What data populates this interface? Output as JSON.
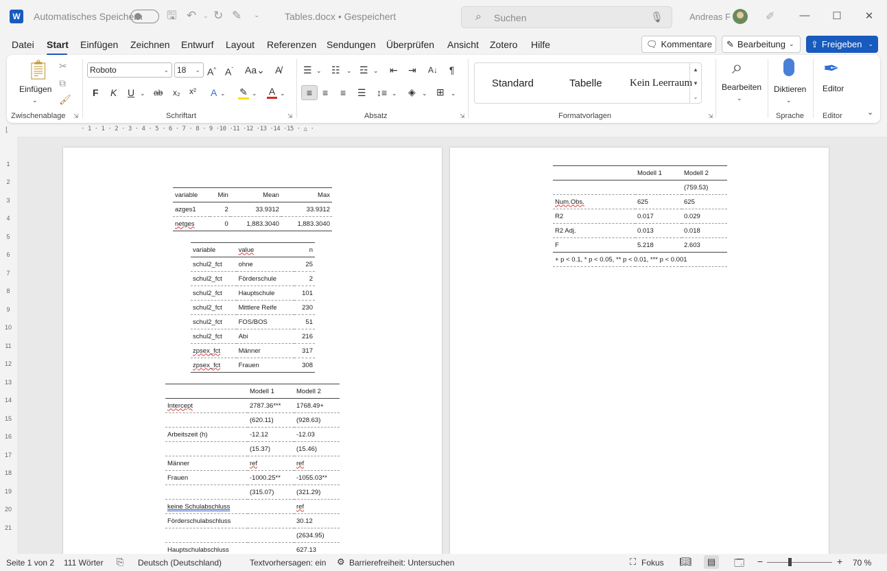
{
  "titlebar": {
    "autosave_label": "Automatisches Speichern",
    "doc_title": "Tables.docx • Gespeichert",
    "search_placeholder": "Suchen",
    "user_name": "Andreas F"
  },
  "menu": {
    "tabs": [
      "Datei",
      "Start",
      "Einfügen",
      "Zeichnen",
      "Entwurf",
      "Layout",
      "Referenzen",
      "Sendungen",
      "Überprüfen",
      "Ansicht",
      "Zotero",
      "Hilfe"
    ],
    "active": "Start",
    "comments_label": "Kommentare",
    "editing_label": "Bearbeitung",
    "share_label": "Freigeben"
  },
  "ribbon": {
    "paste_label": "Einfügen",
    "font_name": "Roboto",
    "font_size": "18",
    "styles": [
      "Standard",
      "Tabelle",
      "Kein Leerraum"
    ],
    "edit_label": "Bearbeiten",
    "dictate_label": "Diktieren",
    "editor_label": "Editor",
    "groups": {
      "clipboard": "Zwischenablage",
      "font": "Schriftart",
      "paragraph": "Absatz",
      "styles": "Formatvorlagen",
      "voice": "Sprache",
      "editor": "Editor"
    }
  },
  "chart_data": [
    {
      "type": "table",
      "columns": [
        "variable",
        "Min",
        "Mean",
        "Max"
      ],
      "rows": [
        [
          "azges1",
          "2",
          "33.9312",
          "33.9312"
        ],
        [
          "netges",
          "0",
          "1,883.3040",
          "1,883.3040"
        ]
      ]
    },
    {
      "type": "table",
      "columns": [
        "variable",
        "value",
        "n"
      ],
      "rows": [
        [
          "schul2_fct",
          "ohne",
          "25"
        ],
        [
          "schul2_fct",
          "Förderschule",
          "2"
        ],
        [
          "schul2_fct",
          "Hauptschule",
          "101"
        ],
        [
          "schul2_fct",
          "Mittlere Reife",
          "230"
        ],
        [
          "schul2_fct",
          "FOS/BOS",
          "51"
        ],
        [
          "schul2_fct",
          "Abi",
          "216"
        ],
        [
          "zpsex_fct",
          "Männer",
          "317"
        ],
        [
          "zpsex_fct",
          "Frauen",
          "308"
        ]
      ]
    },
    {
      "type": "table",
      "columns": [
        "",
        "Modell 1",
        "Modell 2"
      ],
      "rows": [
        [
          "Intercept",
          "2787.36***",
          "1768.49+"
        ],
        [
          "",
          "(620.11)",
          "(928.63)"
        ],
        [
          "Arbeitszeit (h)",
          "-12.12",
          "-12.03"
        ],
        [
          "",
          "(15.37)",
          "(15.46)"
        ],
        [
          "Männer",
          "ref",
          "ref"
        ],
        [
          "Frauen",
          "-1000.25**",
          "-1055.03**"
        ],
        [
          "",
          "(315.07)",
          "(321.29)"
        ],
        [
          "keine Schulabschluss",
          "",
          "ref"
        ],
        [
          "Förderschulabschluss",
          "",
          "30.12"
        ],
        [
          "",
          "",
          "(2634.95)"
        ],
        [
          "Hauptschulabschluss",
          "",
          "627.13"
        ]
      ]
    },
    {
      "type": "table",
      "columns": [
        "",
        "Modell 1",
        "Modell 2"
      ],
      "rows": [
        [
          "",
          "",
          "(759.53)"
        ],
        [
          "Num.Obs.",
          "625",
          "625"
        ],
        [
          "R2",
          "0.017",
          "0.029"
        ],
        [
          "R2 Adj.",
          "0.013",
          "0.018"
        ],
        [
          "F",
          "5.218",
          "2.603"
        ]
      ],
      "note": "+ p < 0.1, * p < 0.05, ** p < 0.01, *** p < 0.001"
    }
  ],
  "statusbar": {
    "page": "Seite 1 von 2",
    "words": "111 Wörter",
    "language": "Deutsch (Deutschland)",
    "predictions": "Textvorhersagen: ein",
    "accessibility": "Barrierefreiheit: Untersuchen",
    "focus": "Fokus",
    "zoom": "70 %"
  },
  "colors": {
    "accent": "#185abd",
    "squiggle": "#d83b3b"
  }
}
